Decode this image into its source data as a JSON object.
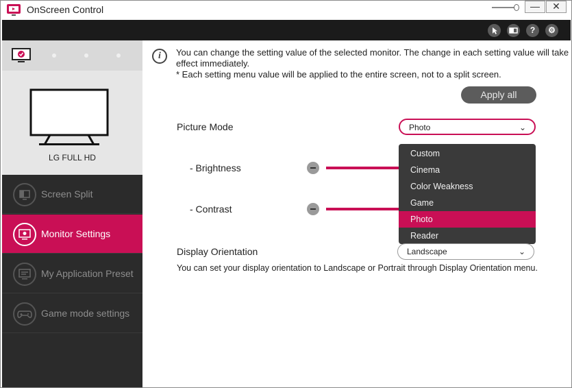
{
  "window": {
    "title": "OnScreen Control",
    "minimize_label": "—",
    "close_label": "✕"
  },
  "toolbar": {
    "icons": [
      "cursor-icon",
      "monitor-toggle-icon",
      "help-icon",
      "gear-icon"
    ],
    "help_label": "?",
    "settings_label": "⚙"
  },
  "sidebar": {
    "monitor_name": "LG FULL HD",
    "items": [
      {
        "label": "Screen Split",
        "active": false
      },
      {
        "label": "Monitor Settings",
        "active": true
      },
      {
        "label": "My Application Preset",
        "active": false
      },
      {
        "label": "Game mode settings",
        "active": false
      }
    ]
  },
  "main": {
    "info_line1": "You can change the setting value of the selected monitor. The change in each setting value will take effect immediately.",
    "info_line2": "* Each setting menu value will be applied to the entire screen, not to a split screen.",
    "apply_all": "Apply all",
    "picture_mode": {
      "label": "Picture Mode",
      "value": "Photo",
      "options": [
        "Custom",
        "Cinema",
        "Color Weakness",
        "Game",
        "Photo",
        "Reader"
      ],
      "selected": "Photo"
    },
    "brightness_label": "- Brightness",
    "contrast_label": "- Contrast",
    "orientation": {
      "label": "Display Orientation",
      "value": "Landscape",
      "note": "You can set your display orientation to Landscape or Portrait through Display Orientation menu."
    }
  },
  "colors": {
    "accent": "#c90f55",
    "sidebar": "#2b2b2b",
    "toolbar": "#1b1b1b"
  }
}
